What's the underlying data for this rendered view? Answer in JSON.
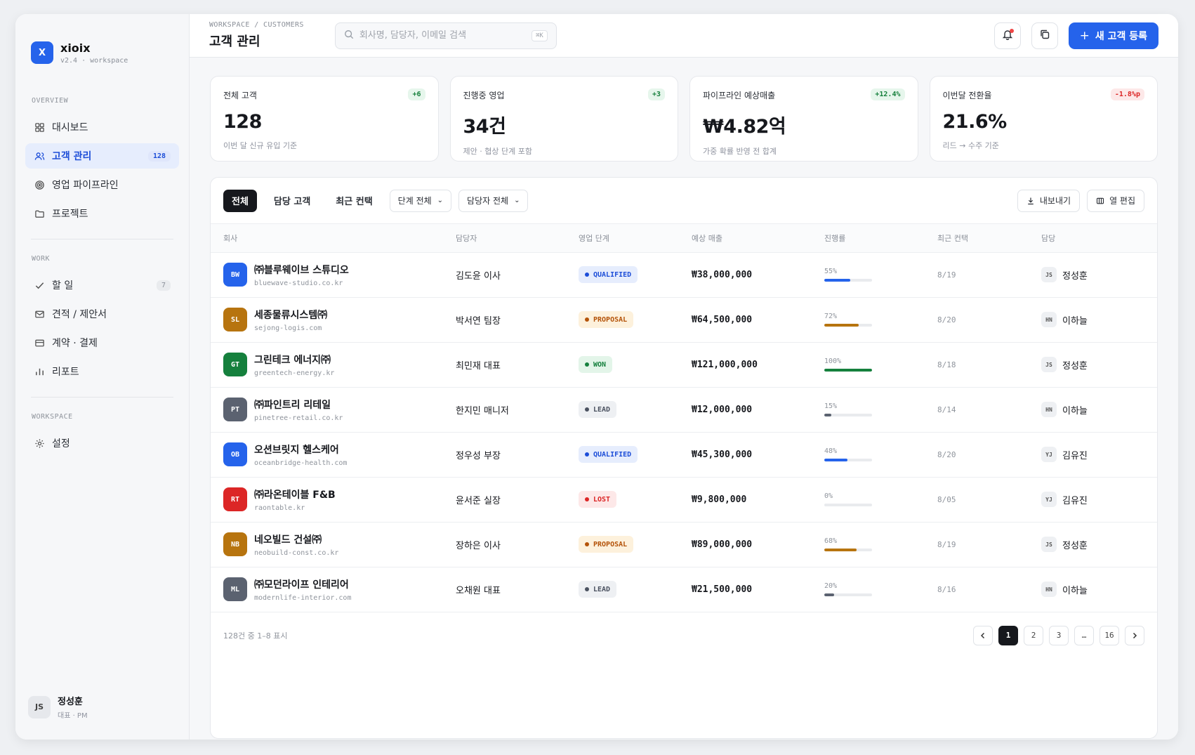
{
  "brand": {
    "logo": "X",
    "name": "xioix",
    "sub": "v2.4 · workspace"
  },
  "sidebar": {
    "sections": [
      {
        "label": "OVERVIEW",
        "items": [
          {
            "icon": "dashboard-icon",
            "label": "대시보드"
          },
          {
            "icon": "users-icon",
            "label": "고객 관리",
            "badge": "128",
            "active": true
          },
          {
            "icon": "target-icon",
            "label": "영업 파이프라인"
          },
          {
            "icon": "folder-icon",
            "label": "프로젝트"
          }
        ]
      },
      {
        "label": "WORK",
        "items": [
          {
            "icon": "check-icon",
            "label": "할 일",
            "badge": "7"
          },
          {
            "icon": "mail-icon",
            "label": "견적 / 제안서"
          },
          {
            "icon": "card-icon",
            "label": "계약 · 결제"
          },
          {
            "icon": "bar-chart-icon",
            "label": "리포트"
          }
        ]
      },
      {
        "label": "WORKSPACE",
        "items": [
          {
            "icon": "gear-icon",
            "label": "설정"
          }
        ]
      }
    ]
  },
  "user": {
    "initials": "JS",
    "name": "정성훈",
    "role": "대표 · PM"
  },
  "header": {
    "breadcrumb": "WORKSPACE / CUSTOMERS",
    "title": "고객 관리",
    "search_placeholder": "회사명, 담당자, 이메일 검색",
    "search_shortcut": "⌘K",
    "new_button": "새 고객 등록"
  },
  "stats": [
    {
      "label": "전체 고객",
      "chip": "+6",
      "trend": "up",
      "value": "128",
      "note": "이번 달 신규 유입 기준"
    },
    {
      "label": "진행중 영업",
      "chip": "+3",
      "trend": "up",
      "value": "34건",
      "note": "제안 · 협상 단계 포함"
    },
    {
      "label": "파이프라인 예상매출",
      "chip": "+12.4%",
      "trend": "up",
      "value": "₩4.82억",
      "note": "가중 확률 반영 전 합계"
    },
    {
      "label": "이번달 전환율",
      "chip": "-1.8%p",
      "trend": "down",
      "value": "21.6%",
      "note": "리드 → 수주 기준"
    }
  ],
  "toolbar": {
    "tabs": [
      "전체",
      "담당 고객",
      "최근 컨택"
    ],
    "filter_stage": "단계 전체",
    "filter_owner": "담당자 전체",
    "export": "내보내기",
    "columns": "열 편집"
  },
  "table": {
    "headers": [
      "회사",
      "담당자",
      "영업 단계",
      "예상 매출",
      "진행률",
      "최근 컨택",
      "담당"
    ],
    "rows": [
      {
        "initials": "BW",
        "color": "#2563eb",
        "name": "㈜블루웨이브 스튜디오",
        "domain": "bluewave-studio.co.kr",
        "contact": "김도윤 이사",
        "stage": "QUALIFIED",
        "revenue": "₩38,000,000",
        "progress": 55,
        "progress_label": "55%",
        "last": "8/19",
        "owner_initials": "JS",
        "owner": "정성훈"
      },
      {
        "initials": "SL",
        "color": "#b7740f",
        "name": "세종물류시스템㈜",
        "domain": "sejong-logis.com",
        "contact": "박서연 팀장",
        "stage": "PROPOSAL",
        "revenue": "₩64,500,000",
        "progress": 72,
        "progress_label": "72%",
        "last": "8/20",
        "owner_initials": "HN",
        "owner": "이하늘"
      },
      {
        "initials": "GT",
        "color": "#15803d",
        "name": "그린테크 에너지㈜",
        "domain": "greentech-energy.kr",
        "contact": "최민재 대표",
        "stage": "WON",
        "revenue": "₩121,000,000",
        "progress": 100,
        "progress_label": "100%",
        "last": "8/18",
        "owner_initials": "JS",
        "owner": "정성훈"
      },
      {
        "initials": "PT",
        "color": "#5b6270",
        "name": "㈜파인트리 리테일",
        "domain": "pinetree-retail.co.kr",
        "contact": "한지민 매니저",
        "stage": "LEAD",
        "revenue": "₩12,000,000",
        "progress": 15,
        "progress_label": "15%",
        "last": "8/14",
        "owner_initials": "HN",
        "owner": "이하늘"
      },
      {
        "initials": "OB",
        "color": "#2563eb",
        "name": "오션브릿지 헬스케어",
        "domain": "oceanbridge-health.com",
        "contact": "정우성 부장",
        "stage": "QUALIFIED",
        "revenue": "₩45,300,000",
        "progress": 48,
        "progress_label": "48%",
        "last": "8/20",
        "owner_initials": "YJ",
        "owner": "김유진"
      },
      {
        "initials": "RT",
        "color": "#dc2626",
        "name": "㈜라온테이블 F&B",
        "domain": "raontable.kr",
        "contact": "윤서준 실장",
        "stage": "LOST",
        "revenue": "₩9,800,000",
        "progress": 0,
        "progress_label": "0%",
        "last": "8/05",
        "owner_initials": "YJ",
        "owner": "김유진"
      },
      {
        "initials": "NB",
        "color": "#b7740f",
        "name": "네오빌드 건설㈜",
        "domain": "neobuild-const.co.kr",
        "contact": "장하은 이사",
        "stage": "PROPOSAL",
        "revenue": "₩89,000,000",
        "progress": 68,
        "progress_label": "68%",
        "last": "8/19",
        "owner_initials": "JS",
        "owner": "정성훈"
      },
      {
        "initials": "ML",
        "color": "#5b6270",
        "name": "㈜모던라이프 인테리어",
        "domain": "modernlife-interior.com",
        "contact": "오채원 대표",
        "stage": "LEAD",
        "revenue": "₩21,500,000",
        "progress": 20,
        "progress_label": "20%",
        "last": "8/16",
        "owner_initials": "HN",
        "owner": "이하늘"
      }
    ]
  },
  "stage_styles": {
    "QUALIFIED": {
      "bg": "#e6edfd",
      "fg": "#1d4ed8",
      "bar": "#2563eb"
    },
    "PROPOSAL": {
      "bg": "#fdf1dc",
      "fg": "#b45309",
      "bar": "#b7740f"
    },
    "WON": {
      "bg": "#e3f5e9",
      "fg": "#15803d",
      "bar": "#15803d"
    },
    "LEAD": {
      "bg": "#eef0f3",
      "fg": "#4b5260",
      "bar": "#5b6270"
    },
    "LOST": {
      "bg": "#fde8e8",
      "fg": "#dc2626",
      "bar": "#dc2626"
    }
  },
  "footer": {
    "info": "128건 중 1–8 표시",
    "pages": [
      "1",
      "2",
      "3",
      "…",
      "16"
    ],
    "current": "1"
  }
}
